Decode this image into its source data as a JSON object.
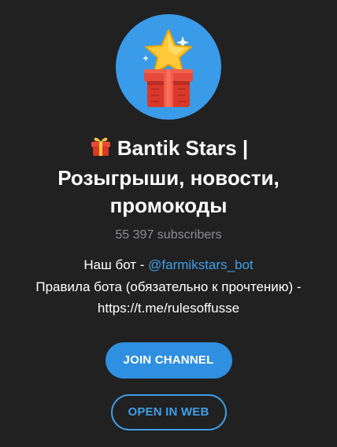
{
  "channel": {
    "avatar_icon": "star-gift-box-icon",
    "title_emoji_icon": "wrapped-gift-emoji-icon",
    "title": "Bantik Stars | Розыгрыши, новости, промокоды",
    "subscribers": "55 397 subscribers",
    "description": {
      "line1_prefix": "Наш бот - ",
      "bot_link": "@farmikstars_bot",
      "line2": "Правила бота (обязательно к прочтению) -",
      "line3": "https://t.me/rulesoffusse"
    }
  },
  "actions": {
    "join_label": "JOIN CHANNEL",
    "open_web_label": "OPEN IN WEB"
  },
  "colors": {
    "background": "#212121",
    "accent": "#3f9ee7",
    "avatar_bg": "#3a9be8",
    "muted_text": "#8e8e93"
  }
}
